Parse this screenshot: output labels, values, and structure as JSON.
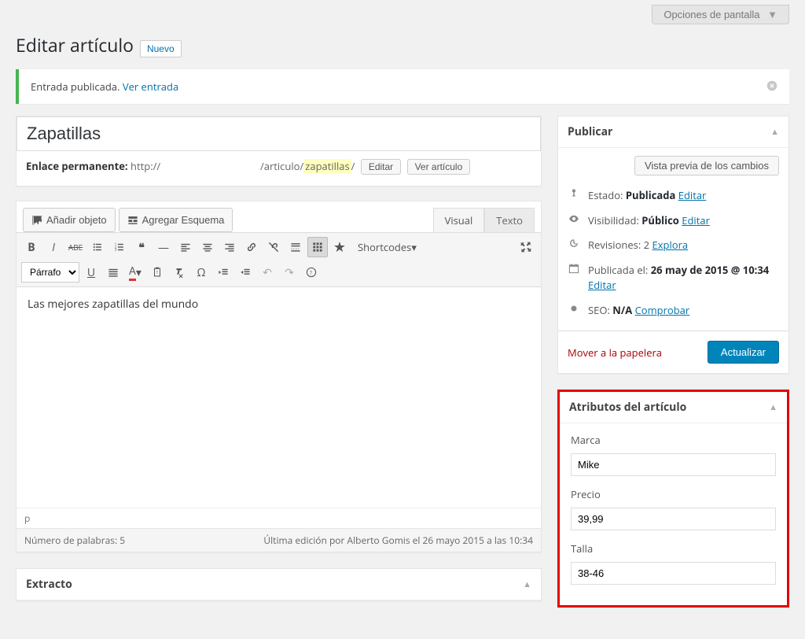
{
  "screen_options_label": "Opciones de pantalla",
  "page_title": "Editar artículo",
  "add_new_label": "Nuevo",
  "notice": {
    "text": "Entrada publicada.",
    "link_text": "Ver entrada"
  },
  "post": {
    "title": "Zapatillas",
    "permalink_label": "Enlace permanente:",
    "permalink_prefix": "http://",
    "permalink_mid": "/articulo/",
    "slug": "zapatillas",
    "permalink_suffix": "/",
    "edit_btn": "Editar",
    "view_btn": "Ver artículo",
    "content": "Las mejores zapatillas del mundo",
    "status_path": "p",
    "word_count_label": "Número de palabras:",
    "word_count": "5",
    "last_edit": "Última edición por Alberto Gomis el 26 mayo 2015 a las 10:34"
  },
  "editor": {
    "add_media": "Añadir objeto",
    "add_schema": "Agregar Esquema",
    "tab_visual": "Visual",
    "tab_text": "Texto",
    "format_select": "Párrafo",
    "shortcodes": "Shortcodes"
  },
  "publish": {
    "box_title": "Publicar",
    "preview_btn": "Vista previa de los cambios",
    "status_label": "Estado:",
    "status_value": "Publicada",
    "status_edit": "Editar",
    "visibility_label": "Visibilidad:",
    "visibility_value": "Público",
    "visibility_edit": "Editar",
    "revisions_label": "Revisiones:",
    "revisions_value": "2",
    "revisions_link": "Explora",
    "date_label": "Publicada el:",
    "date_value": "26 may de 2015 @ 10:34",
    "date_edit": "Editar",
    "seo_label": "SEO:",
    "seo_value": "N/A",
    "seo_link": "Comprobar",
    "delete_link": "Mover a la papelera",
    "submit_btn": "Actualizar"
  },
  "attributes": {
    "box_title": "Atributos del artículo",
    "fields": [
      {
        "label": "Marca",
        "value": "Mike"
      },
      {
        "label": "Precio",
        "value": "39,99"
      },
      {
        "label": "Talla",
        "value": "38-46"
      }
    ]
  },
  "excerpt": {
    "box_title": "Extracto"
  }
}
